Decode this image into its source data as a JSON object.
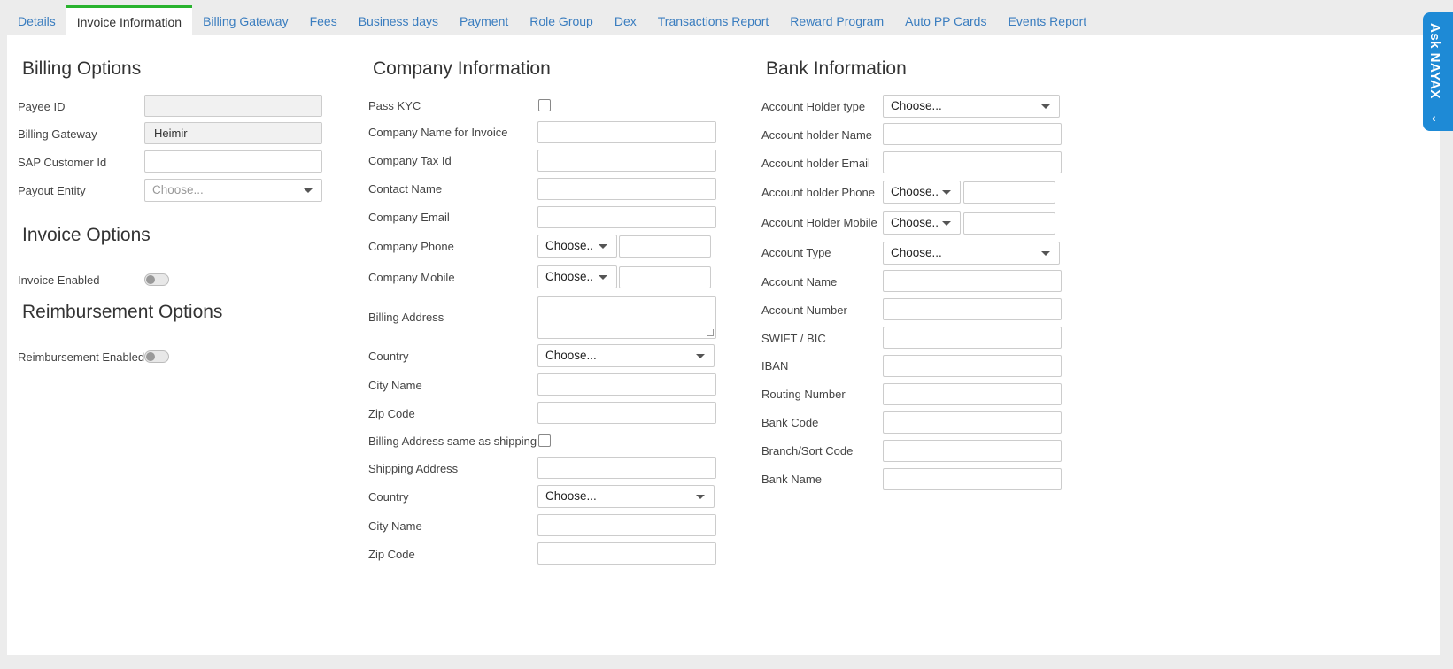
{
  "tabs": [
    {
      "label": "Details",
      "active": false
    },
    {
      "label": "Invoice Information",
      "active": true
    },
    {
      "label": "Billing Gateway",
      "active": false
    },
    {
      "label": "Fees",
      "active": false
    },
    {
      "label": "Business days",
      "active": false
    },
    {
      "label": "Payment",
      "active": false
    },
    {
      "label": "Role Group",
      "active": false
    },
    {
      "label": "Dex",
      "active": false
    },
    {
      "label": "Transactions Report",
      "active": false
    },
    {
      "label": "Reward Program",
      "active": false
    },
    {
      "label": "Auto PP Cards",
      "active": false
    },
    {
      "label": "Events Report",
      "active": false
    }
  ],
  "billing": {
    "title": "Billing Options",
    "payee_id_label": "Payee ID",
    "payee_id_value": "",
    "gateway_label": "Billing Gateway",
    "gateway_value": "Heimir",
    "sap_label": "SAP Customer Id",
    "sap_value": "",
    "payout_label": "Payout Entity",
    "payout_placeholder": "Choose..."
  },
  "invoice": {
    "title": "Invoice Options",
    "enabled_label": "Invoice Enabled"
  },
  "reimbursement": {
    "title": "Reimbursement Options",
    "enabled_label": "Reimbursement Enabled"
  },
  "company": {
    "title": "Company Information",
    "pass_kyc": "Pass KYC",
    "name_invoice": "Company Name for Invoice",
    "tax_id": "Company Tax Id",
    "contact": "Contact Name",
    "email": "Company Email",
    "phone": "Company Phone",
    "mobile": "Company Mobile",
    "billing_address": "Billing Address",
    "country": "Country",
    "city": "City Name",
    "zip": "Zip Code",
    "same_as_shipping": "Billing Address same as shipping",
    "shipping_address": "Shipping Address",
    "ship_country": "Country",
    "ship_city": "City Name",
    "ship_zip": "Zip Code",
    "choose_short": "Choose..",
    "choose": "Choose..."
  },
  "bank": {
    "title": "Bank Information",
    "holder_type": "Account Holder type",
    "holder_name": "Account holder Name",
    "holder_email": "Account holder Email",
    "holder_phone": "Account holder Phone",
    "holder_mobile": "Account Holder Mobile",
    "account_type": "Account Type",
    "account_name": "Account Name",
    "account_number": "Account Number",
    "swift": "SWIFT / BIC",
    "iban": "IBAN",
    "routing": "Routing Number",
    "bank_code": "Bank Code",
    "branch": "Branch/Sort Code",
    "bank_name": "Bank Name",
    "choose_short": "Choose..",
    "choose": "Choose..."
  },
  "ask": {
    "label": "Ask NAYAX",
    "chevron": "‹"
  },
  "colors": {
    "accent_tab": "#29b32e",
    "link": "#3a7dbf",
    "ask_bg": "#1e8ad6"
  }
}
